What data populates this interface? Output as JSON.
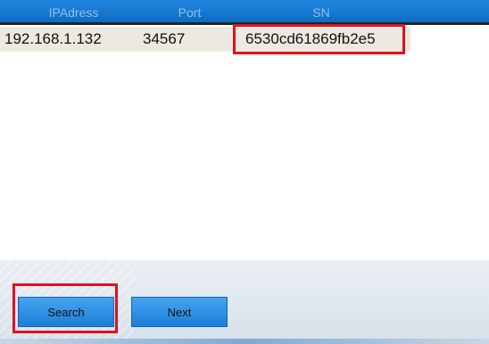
{
  "table": {
    "headers": {
      "ip": "IPAdress",
      "port": "Port",
      "sn": "SN"
    },
    "rows": [
      {
        "ip": "192.168.1.132",
        "port": "34567",
        "sn": "6530cd61869fb2e5"
      }
    ]
  },
  "buttons": {
    "search_label": "Search",
    "next_label": "Next"
  },
  "colors": {
    "header_bg": "#1a7fd8",
    "row_bg": "#eceae0",
    "highlight": "#e0111e",
    "button_bg": "#2f8fe3"
  }
}
